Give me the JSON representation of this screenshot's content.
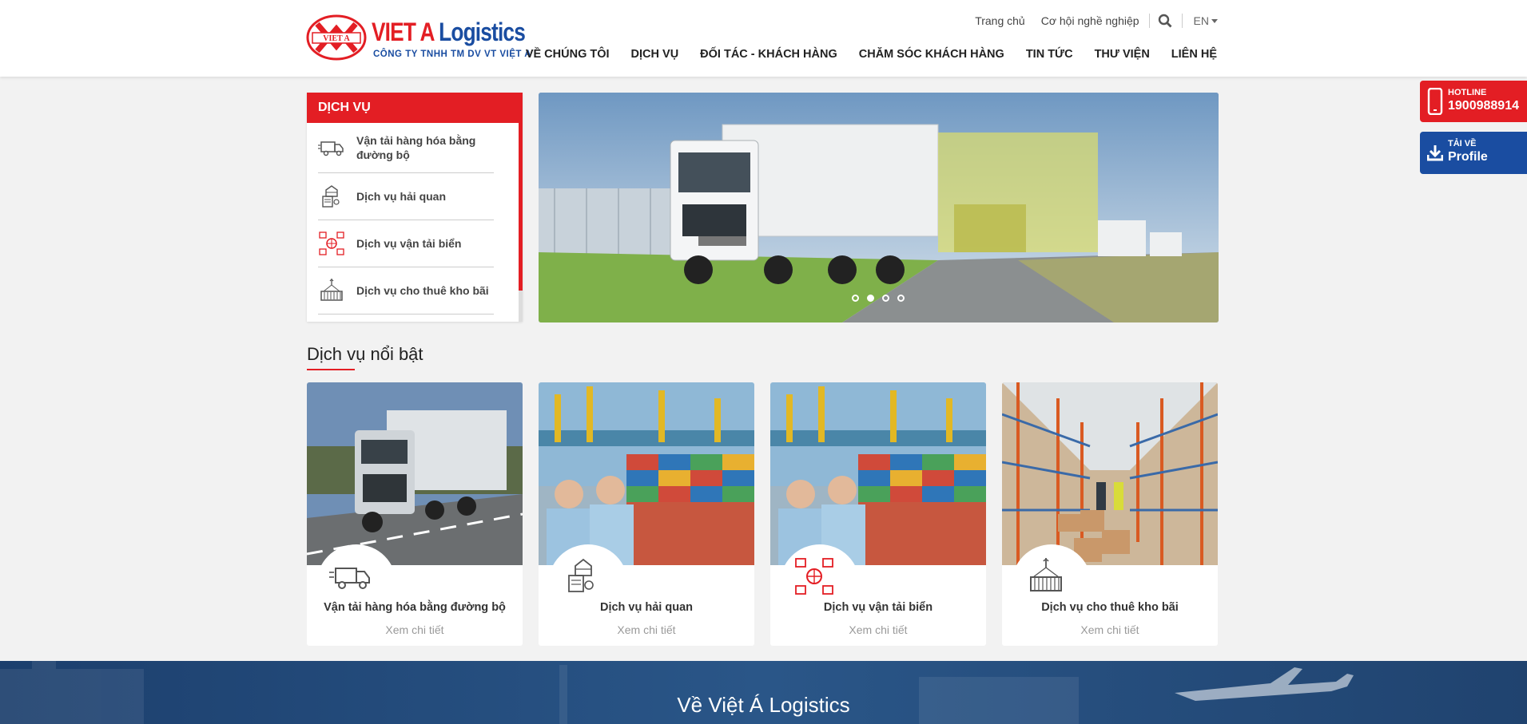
{
  "logo": {
    "name_red": "VIET A",
    "name_blue": "Logistics",
    "mark_text": "VIET A",
    "subtitle": "CÔNG TY TNHH TM DV VT VIỆT A"
  },
  "top_links": {
    "home": "Trang chủ",
    "careers": "Cơ hội nghề nghiệp",
    "lang": "EN"
  },
  "nav": [
    "VỀ CHÚNG TÔI",
    "DỊCH VỤ",
    "ĐỐI TÁC - KHÁCH HÀNG",
    "CHĂM SÓC KHÁCH HÀNG",
    "TIN TỨC",
    "THƯ VIỆN",
    "LIÊN HỆ"
  ],
  "services_box": {
    "title": "DỊCH VỤ",
    "items": [
      {
        "label": "Vận tải hàng hóa bằng đường bộ",
        "icon": "truck-icon"
      },
      {
        "label": "Dịch vụ hải quan",
        "icon": "customs-icon"
      },
      {
        "label": "Dịch vụ vận tải biển",
        "icon": "sea-transport-icon"
      },
      {
        "label": "Dịch vụ cho thuê kho bãi",
        "icon": "warehouse-icon"
      }
    ]
  },
  "banner": {
    "dots": 4,
    "active_dot": 1
  },
  "featured": {
    "title": "Dịch vụ nổi bật",
    "cards": [
      {
        "title": "Vận tải hàng hóa bằng đường bộ",
        "link": "Xem chi tiết",
        "icon": "truck-icon"
      },
      {
        "title": "Dịch vụ hải quan",
        "link": "Xem chi tiết",
        "icon": "customs-icon"
      },
      {
        "title": "Dịch vụ vận tải biển",
        "link": "Xem chi tiết",
        "icon": "sea-transport-icon"
      },
      {
        "title": "Dịch vụ cho thuê kho bãi",
        "link": "Xem chi tiết",
        "icon": "warehouse-icon"
      }
    ]
  },
  "about": {
    "title": "Về Việt Á Logistics"
  },
  "floating": {
    "hotline_label": "HOTLINE",
    "hotline_number": "1900988914",
    "profile_label": "TẢI VỀ",
    "profile_text": "Profile"
  },
  "colors": {
    "brand_red": "#e31e24",
    "brand_blue": "#1a4da1"
  }
}
